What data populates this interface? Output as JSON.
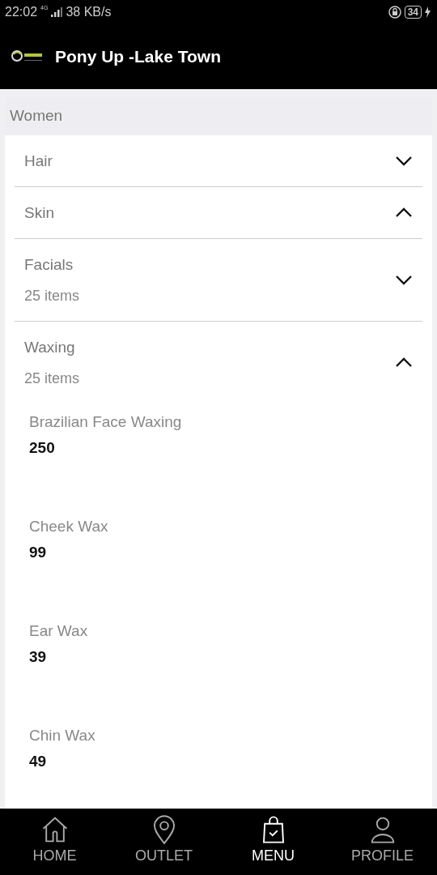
{
  "status_bar": {
    "time": "22:02",
    "network": "4G",
    "speed": "38 KB/s",
    "battery": "34"
  },
  "header": {
    "title": "Pony Up -Lake Town"
  },
  "section": {
    "title": "Women"
  },
  "categories": [
    {
      "name": "Hair",
      "expanded": false
    },
    {
      "name": "Skin",
      "expanded": true
    },
    {
      "name": "Facials",
      "count": "25 items",
      "expanded": false
    },
    {
      "name": "Waxing",
      "count": "25 items",
      "expanded": true,
      "items": [
        {
          "name": "Brazilian Face Waxing",
          "price": "250"
        },
        {
          "name": "Cheek Wax",
          "price": "99"
        },
        {
          "name": "Ear Wax",
          "price": "39"
        },
        {
          "name": "Chin Wax",
          "price": "49"
        }
      ]
    }
  ],
  "nav": [
    {
      "label": "HOME",
      "kind": "home",
      "selected": false
    },
    {
      "label": "OUTLET",
      "kind": "outlet",
      "selected": false
    },
    {
      "label": "MENU",
      "kind": "menu",
      "selected": true
    },
    {
      "label": "PROFILE",
      "kind": "profile",
      "selected": false
    }
  ]
}
